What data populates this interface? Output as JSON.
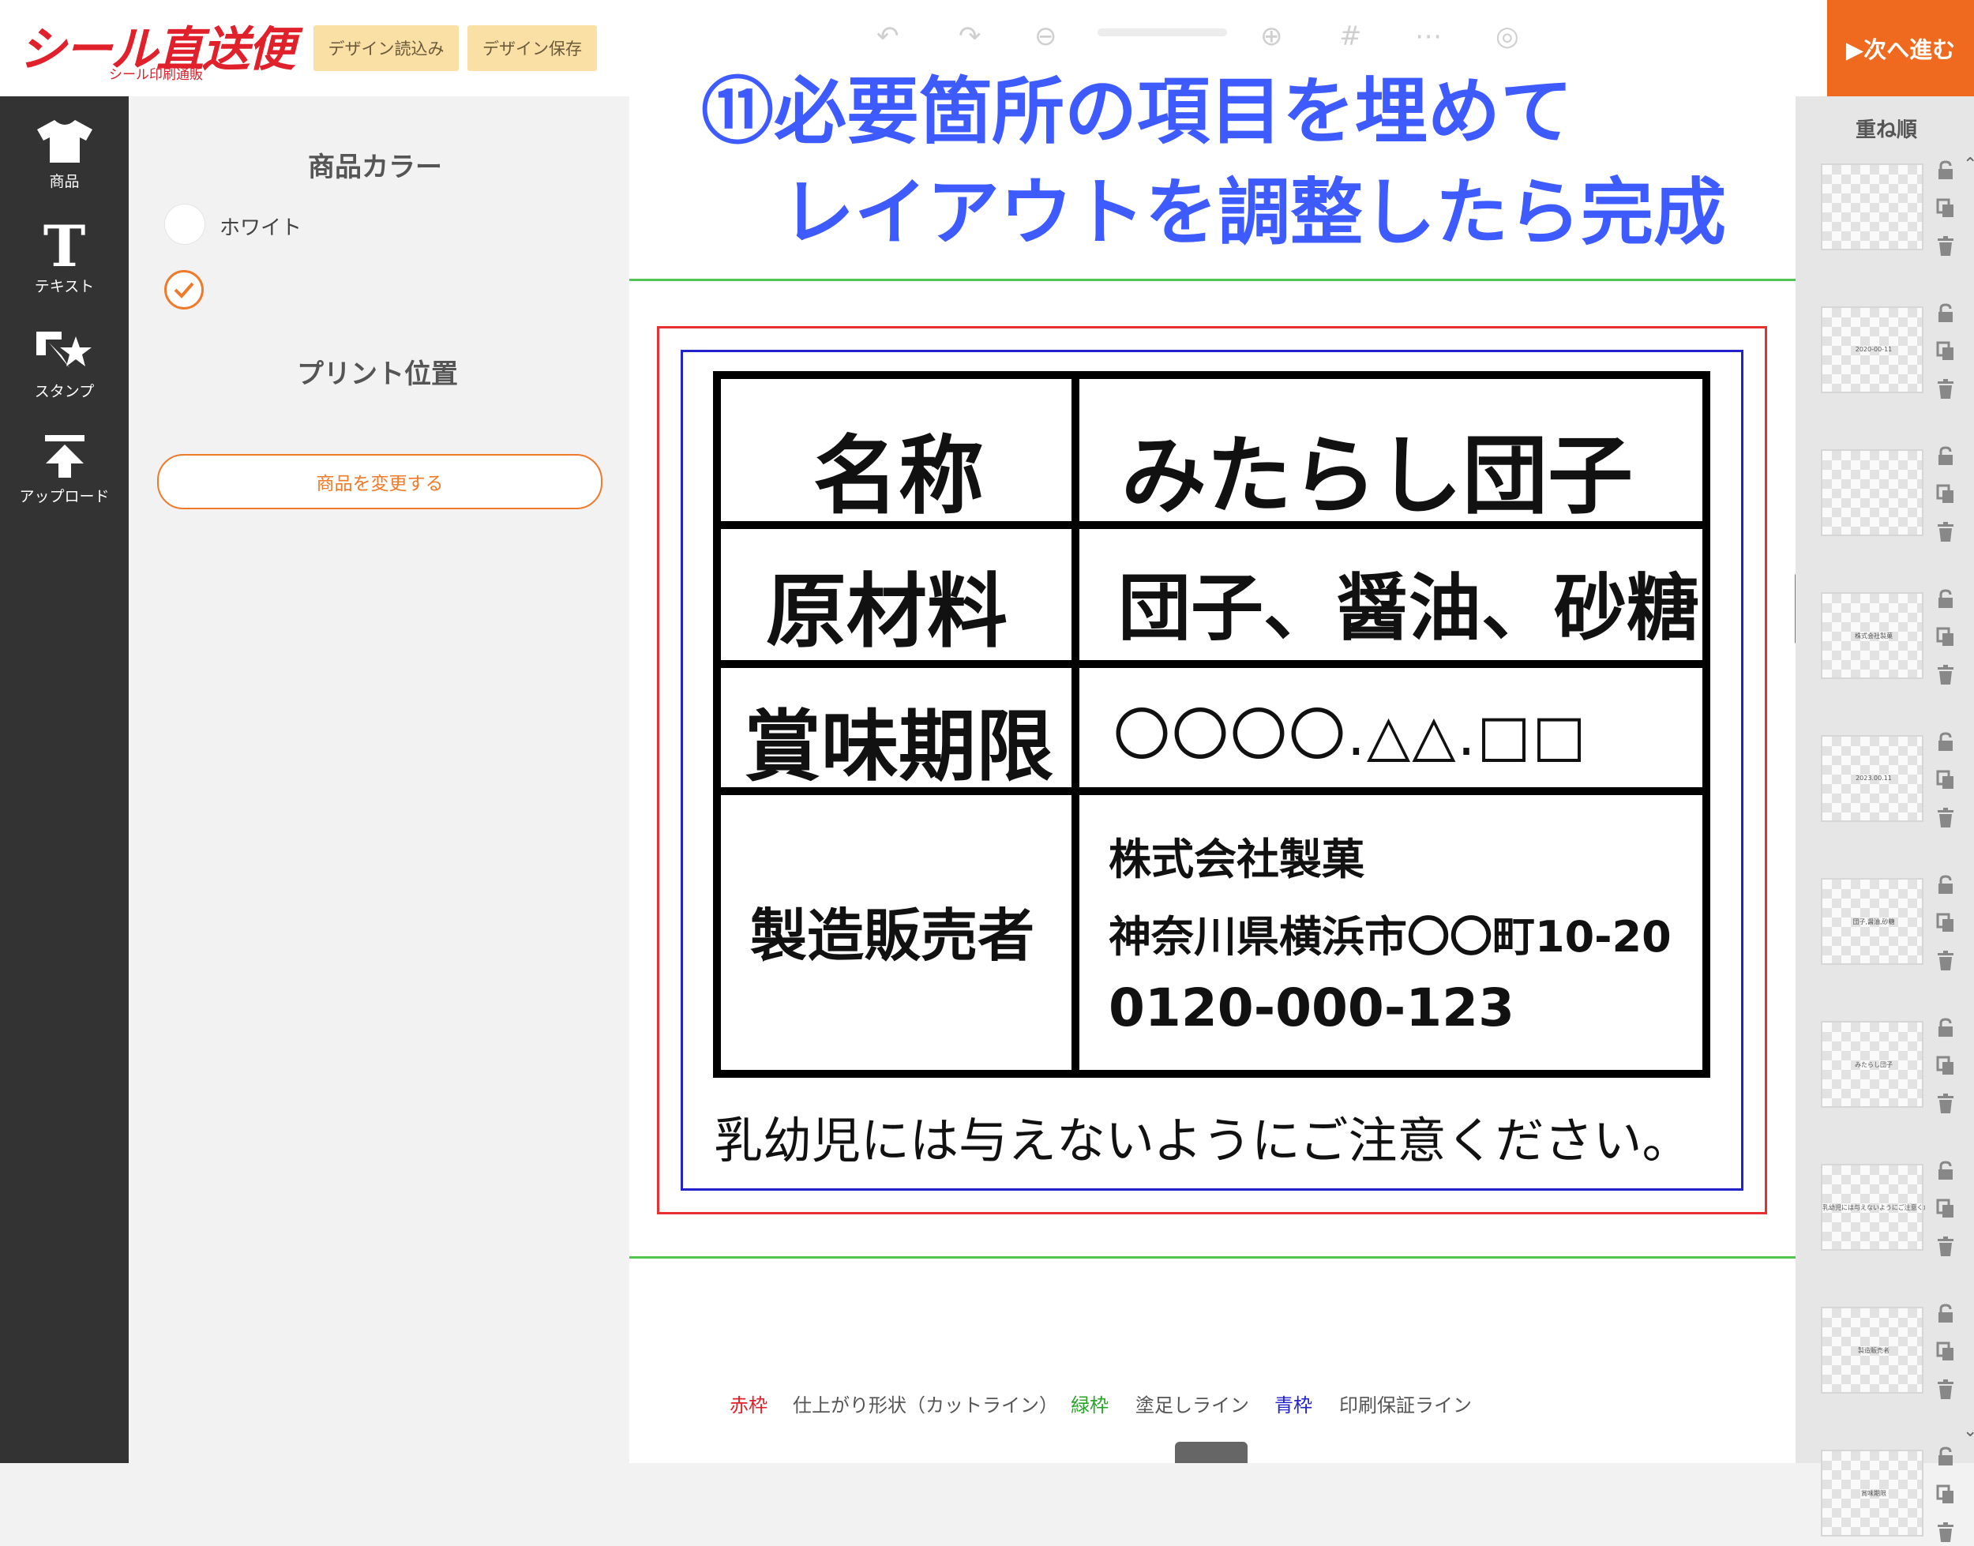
{
  "header": {
    "logo": "シール直送便",
    "logo_sub": "シール印刷通販",
    "load_design": "デザイン読込み",
    "save_design": "デザイン保存",
    "next": "▶次へ進む"
  },
  "toolbar": {
    "items": [
      {
        "label": "商品",
        "icon": "tshirt-icon"
      },
      {
        "label": "テキスト",
        "icon": "text-icon"
      },
      {
        "label": "スタンプ",
        "icon": "stamp-icon"
      },
      {
        "label": "アップロード",
        "icon": "upload-icon"
      }
    ]
  },
  "panel": {
    "color_title": "商品カラー",
    "color_option_white": "ホワイト",
    "print_position_title": "プリント位置",
    "change_product": "商品を変更する"
  },
  "instruction": {
    "line1": "⑪必要箇所の項目を埋めて",
    "line2": "レイアウトを調整したら完成"
  },
  "label": {
    "name_key": "名称",
    "name_value": "みたらし団子",
    "ingredients_key": "原材料",
    "ingredients_value": "団子、醤油、砂糖",
    "expiry_key": "賞味期限",
    "expiry_value": "〇〇〇〇.△△.□□",
    "maker_key": "製造販売者",
    "maker_company": "株式会社製菓",
    "maker_address": "神奈川県横浜市〇〇町10-20",
    "maker_phone": "0120-000-123",
    "notice": "乳幼児には与えないようにご注意ください。"
  },
  "legend": {
    "red_key": "赤枠",
    "red_desc": "仕上がり形状（カットライン）",
    "green_key": "緑枠",
    "green_desc": "塗足しライン",
    "blue_key": "青枠",
    "blue_desc": "印刷保証ライン"
  },
  "layers": {
    "title": "重ね順",
    "thumbs": [
      "",
      "2020-00-11",
      "",
      "株式会社製菓",
      "2023.00.11",
      "団子,醤油,砂糖",
      "みたらし団子",
      "乳幼児には与えないようにご注意ください。",
      "製造販売者",
      "賞味期限"
    ]
  },
  "colors": {
    "accent": "#ef6a1f",
    "brand_red": "#e0202a",
    "instruction_blue": "#3d5bff",
    "cut_line_red": "#e83030",
    "bleed_green": "#2aa52a",
    "safe_blue": "#2222cc"
  }
}
